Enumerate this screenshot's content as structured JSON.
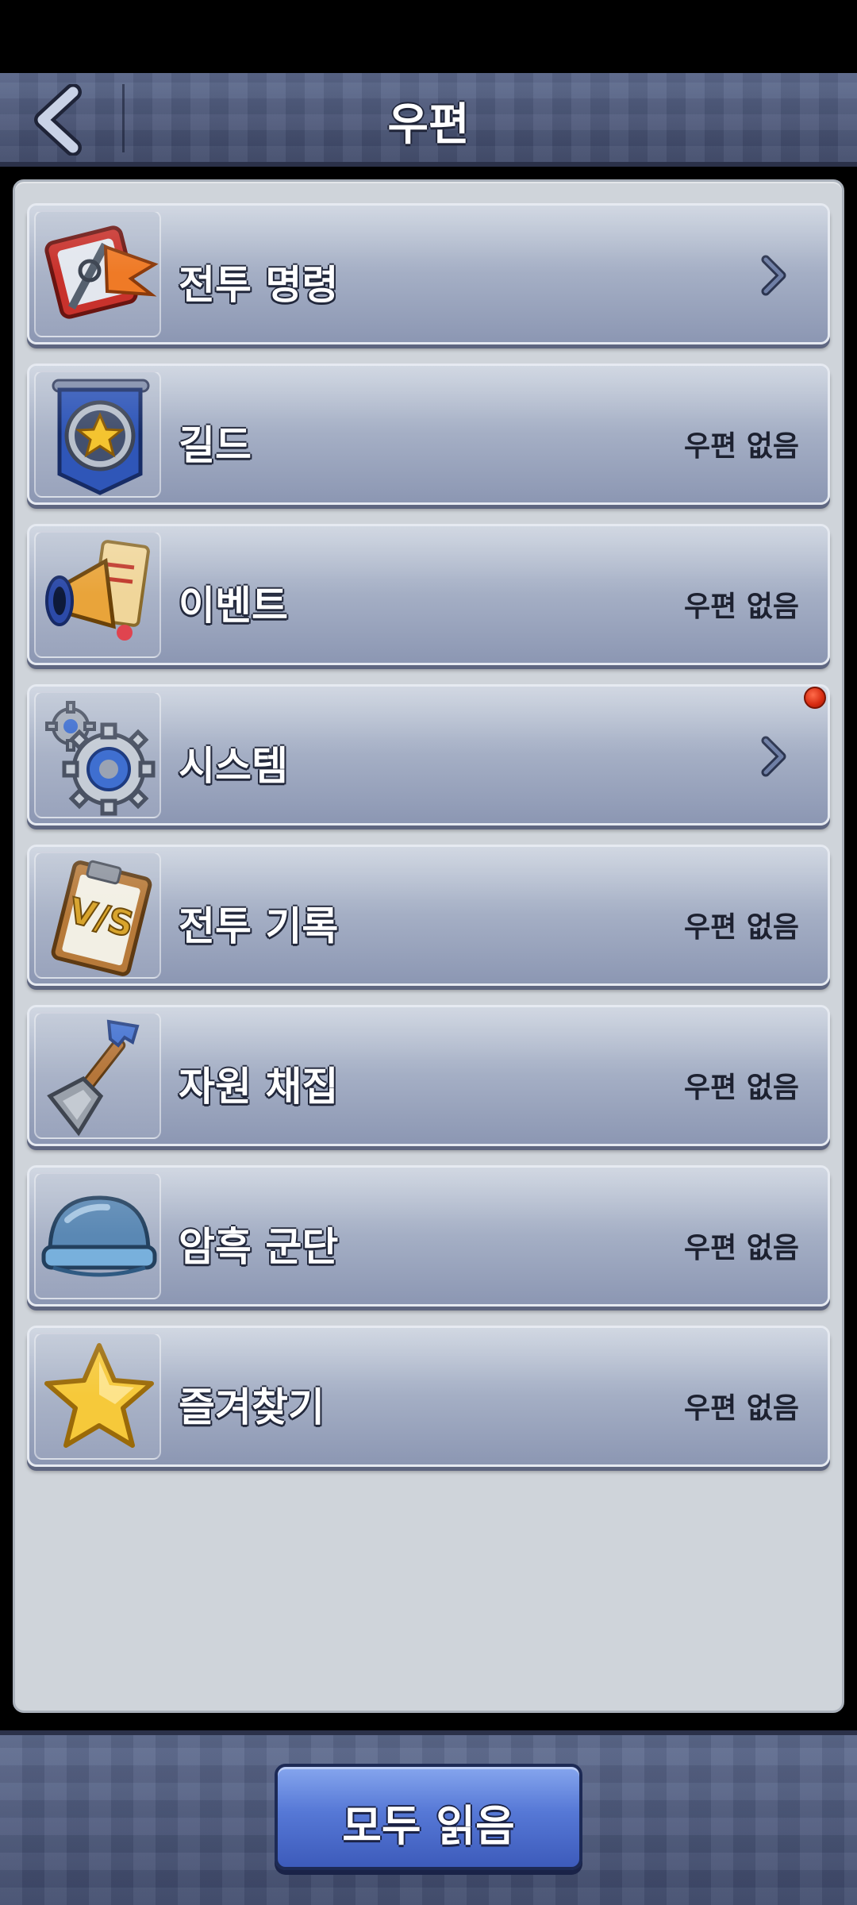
{
  "header": {
    "title": "우편",
    "back_icon": "chevron-left-icon"
  },
  "mail_categories": [
    {
      "label": "전투 명령",
      "status": "",
      "icon": "battle-order-flag-icon",
      "has_arrow": true,
      "has_notification": false
    },
    {
      "label": "길드",
      "status": "우편 없음",
      "icon": "guild-star-banner-icon",
      "has_arrow": false,
      "has_notification": false
    },
    {
      "label": "이벤트",
      "status": "우편 없음",
      "icon": "event-megaphone-icon",
      "has_arrow": false,
      "has_notification": false
    },
    {
      "label": "시스템",
      "status": "",
      "icon": "system-gears-icon",
      "has_arrow": true,
      "has_notification": true
    },
    {
      "label": "전투 기록",
      "status": "우편 없음",
      "icon": "battle-record-vs-clipboard-icon",
      "has_arrow": false,
      "has_notification": false
    },
    {
      "label": "자원 채집",
      "status": "우편 없음",
      "icon": "gathering-shovel-icon",
      "has_arrow": false,
      "has_notification": false
    },
    {
      "label": "암흑 군단",
      "status": "우편 없음",
      "icon": "dark-legion-helmet-icon",
      "has_arrow": false,
      "has_notification": false
    },
    {
      "label": "즐겨찾기",
      "status": "우편 없음",
      "icon": "favorite-star-icon",
      "has_arrow": false,
      "has_notification": false
    }
  ],
  "footer": {
    "read_all_label": "모두 읽음"
  },
  "colors": {
    "header_bg": "#4e5a7c",
    "panel_bg": "#cfd4da",
    "row_bg": "#a9b3c8",
    "button_blue": "#5678d6",
    "notification_red": "#d52a10"
  }
}
